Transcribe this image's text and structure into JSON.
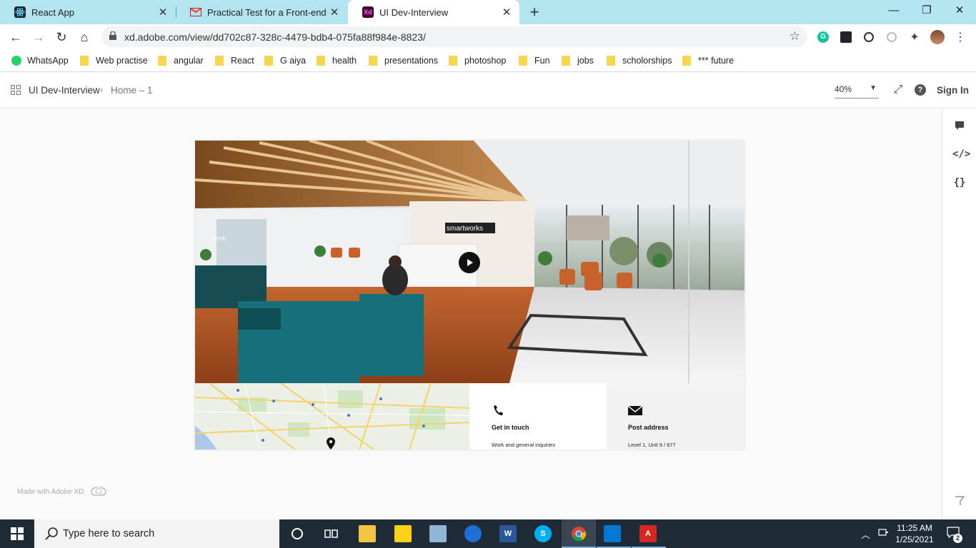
{
  "browser": {
    "tabs": [
      {
        "title": "React App"
      },
      {
        "title": "Practical Test for a Front-end Dev"
      },
      {
        "title": "UI Dev-Interview"
      }
    ],
    "favicon_letters": {
      "xd": "Xd"
    },
    "url": "xd.adobe.com/view/dd702c87-328c-4479-bdb4-075fa88f984e-8823/",
    "bookmarks": [
      {
        "label": "WhatsApp"
      },
      {
        "label": "Web practise"
      },
      {
        "label": "angular"
      },
      {
        "label": "React"
      },
      {
        "label": "G aiya"
      },
      {
        "label": "health"
      },
      {
        "label": "presentations"
      },
      {
        "label": "photoshop"
      },
      {
        "label": "Fun"
      },
      {
        "label": "jobs"
      },
      {
        "label": "scholorships"
      },
      {
        "label": "*** future"
      }
    ]
  },
  "xd": {
    "project": "UI Dev-Interview",
    "page": "Home – 1",
    "zoom": "40%",
    "sign_in": "Sign In",
    "made_with": "Made with Adobe XD"
  },
  "artboard": {
    "brand_sign": "smartworks",
    "wall_text": "work",
    "contact": {
      "title": "Get in touch",
      "text": "Work and general inquiries"
    },
    "postal": {
      "title": "Post address",
      "text": "Level 1, Unit 9 / 677"
    }
  },
  "taskbar": {
    "search_placeholder": "Type here to search",
    "time": "11:25 AM",
    "date": "1/25/2021",
    "notification_count": "2"
  },
  "colors": {
    "tabstrip": "#b3e5f0",
    "taskbar": "#1e2a36",
    "teal_sofa": "#16707a",
    "floor_orange": "#b7562a"
  }
}
